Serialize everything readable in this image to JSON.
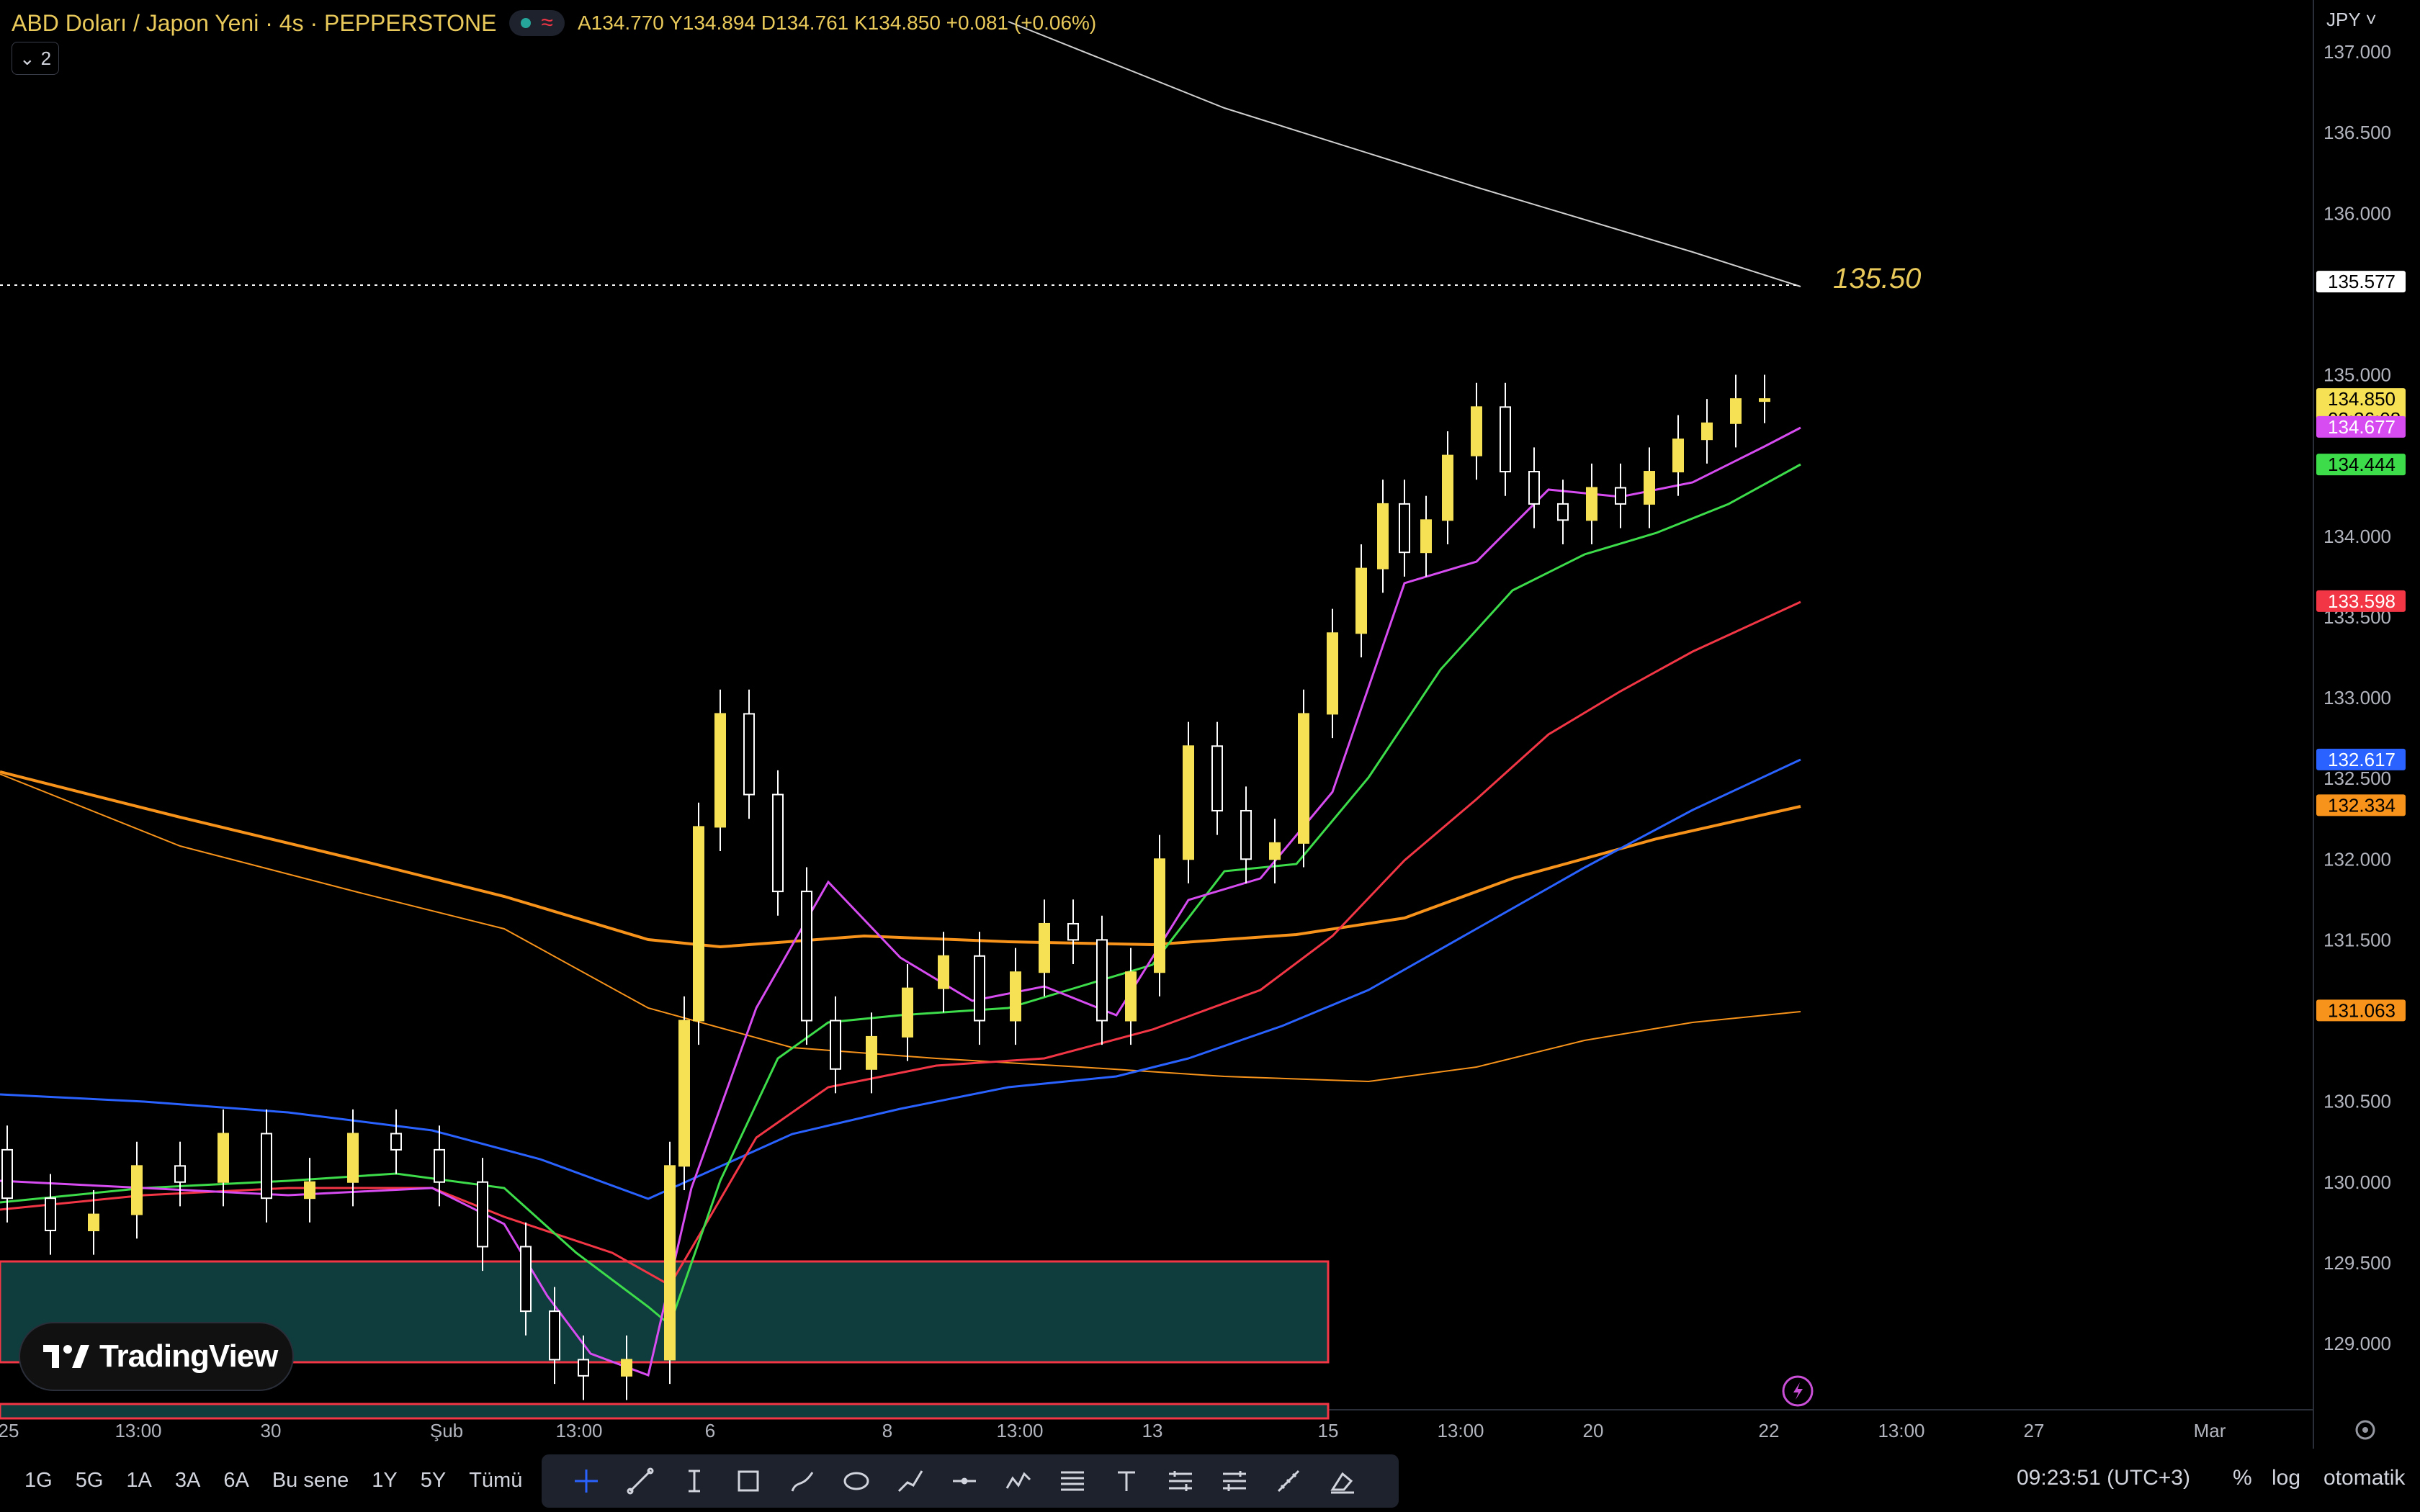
{
  "header": {
    "symbol_title": "ABD Doları / Japon Yeni · 4s · PEPPERSTONE",
    "ohlc": "A134.770  Y134.894  D134.761  K134.850  +0.081 (+0.06%)",
    "indicators_collapse_count": "2"
  },
  "currency": "JPY",
  "price_axis": {
    "ticks": [
      "137.000",
      "136.500",
      "136.000",
      "135.000",
      "134.000",
      "133.500",
      "133.000",
      "132.500",
      "132.000",
      "131.500",
      "130.500",
      "130.000",
      "129.500",
      "129.000"
    ],
    "tags": [
      {
        "value": "135.577",
        "bg": "#ffffff",
        "fg": "#000000"
      },
      {
        "value": "134.850",
        "sub": "03:36:08",
        "bg": "#f5e153",
        "fg": "#000000"
      },
      {
        "value": "134.677",
        "bg": "#d64cf0",
        "fg": "#ffffff"
      },
      {
        "value": "134.444",
        "bg": "#3ddc4a",
        "fg": "#000000"
      },
      {
        "value": "133.598",
        "bg": "#f23645",
        "fg": "#ffffff"
      },
      {
        "value": "132.617",
        "bg": "#2962ff",
        "fg": "#ffffff"
      },
      {
        "value": "132.334",
        "bg": "#f7931a",
        "fg": "#000000"
      },
      {
        "value": "131.063",
        "bg": "#f7931a",
        "fg": "#000000"
      }
    ]
  },
  "time_axis": [
    "25",
    "13:00",
    "30",
    "Şub",
    "13:00",
    "6",
    "8",
    "13:00",
    "13",
    "15",
    "13:00",
    "20",
    "22",
    "13:00",
    "27",
    "Mar"
  ],
  "horizontal_line_label": "135.50",
  "bottom": {
    "timeframes": [
      "1G",
      "5G",
      "1A",
      "3A",
      "6A",
      "Bu sene",
      "1Y",
      "5Y",
      "Tümü"
    ],
    "clock": "09:23:51 (UTC+3)",
    "percent": "%",
    "log": "log",
    "auto": "otomatik"
  },
  "logo_text": "TradingView",
  "colors": {
    "candle_up": "#f5e153",
    "candle_down": "#000000",
    "ema_fast": "#d64cf0",
    "ema_green": "#3ddc4a",
    "ema_red": "#f23645",
    "ema_blue": "#2962ff",
    "ema_orange": "#f7931a",
    "zone_fill": "#0f3d3d",
    "zone_border": "#f23645"
  }
}
